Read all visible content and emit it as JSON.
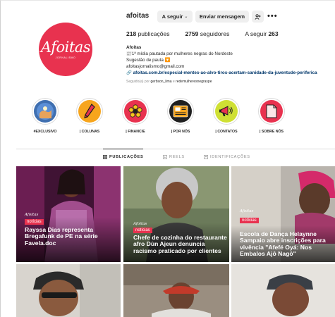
{
  "profile": {
    "username": "afoitas",
    "follow_label": "A seguir",
    "message_label": "Enviar mensagem",
    "avatar_text": "Afoitas",
    "avatar_sub": "JORNALISMO"
  },
  "stats": {
    "posts_count": "218",
    "posts_label": "publicações",
    "followers_count": "2759",
    "followers_label": "seguidores",
    "following_label": "A seguir",
    "following_count": "263"
  },
  "bio": {
    "name": "Afoitas",
    "line1": "📰1ª mídia pautada por mulheres negras do Nordeste",
    "line2": "Sugestão de pauta 🔽",
    "line3": "afoitasjornalismo@gmail.com",
    "link": "afoitas.com.br/especial-mentes-ao-alvo-tiros-acertam-sanidade-da-juventude-periferica",
    "followed_prefix": "Seguido(a) por",
    "followed_user1": "gerbson_lima",
    "followed_and": "e",
    "followed_user2": "redemulheresnegraspe"
  },
  "highlights": [
    {
      "label": "#EXCLUSIVO",
      "color": "#3f6fb0",
      "icon": "globe-icon"
    },
    {
      "label": "| COLUNAS",
      "color": "#f7a51d",
      "icon": "pen-icon"
    },
    {
      "label": "| FINANCIE",
      "color": "#e8324f",
      "icon": "flower-icon"
    },
    {
      "label": "| POR NÓS",
      "color": "#1f1f1f",
      "icon": "newspaper-icon"
    },
    {
      "label": "| CONTATOS",
      "color": "#cfe034",
      "icon": "megaphone-icon"
    },
    {
      "label": "| SOBRE NÓS",
      "color": "#e8324f",
      "icon": "paper-icon"
    }
  ],
  "tabs": {
    "posts": "PUBLICAÇÕES",
    "reels": "REELS",
    "tagged": "IDENTIFICAÇÕES"
  },
  "posts": [
    {
      "brand": "Afoitas",
      "tag": "notícias",
      "title": "Rayssa Dias representa Bregafunk de PE na série Favela.doc"
    },
    {
      "brand": "Afoitas",
      "tag": "notícias",
      "title": "Chefe de cozinha do restaurante afro Dùn Ajeun denuncia racismo praticado por clientes"
    },
    {
      "brand": "Afoitas",
      "tag": "notícias",
      "title": "Escola de Dança Helaynne Sampaio abre inscrições para vivência \"Afefé Oyá: Nos Embalos Ajô Nagô\""
    }
  ],
  "colors": {
    "brand": "#e8324f",
    "link": "#00376b",
    "muted": "#8e8e8e"
  }
}
